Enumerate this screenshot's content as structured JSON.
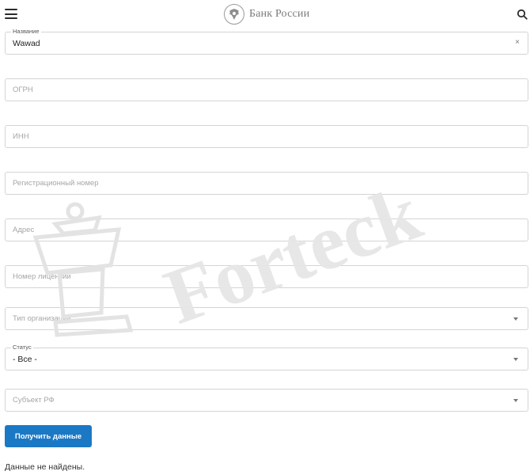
{
  "header": {
    "logo_text": "Банк России",
    "menu_icon": "hamburger-icon",
    "search_icon": "search-icon",
    "logo_icon": "double-eagle-emblem"
  },
  "form": {
    "name": {
      "legend": "Название",
      "value": "Wawad",
      "clear": "×"
    },
    "ogrn": {
      "placeholder": "ОГРН"
    },
    "inn": {
      "placeholder": "ИНН"
    },
    "reg_number": {
      "placeholder": "Регистрационный номер"
    },
    "address": {
      "placeholder": "Адрес"
    },
    "license_number": {
      "placeholder": "Номер лицензии"
    },
    "org_type": {
      "placeholder": "Тип организации"
    },
    "status": {
      "legend": "Статус",
      "value": "- Все -"
    },
    "region": {
      "placeholder": "Субъект РФ"
    },
    "submit_label": "Получить данные"
  },
  "result": {
    "message": "Данные не найдены."
  },
  "watermark": {
    "text": "Forteck",
    "color": "#e6e6e6"
  },
  "colors": {
    "accent": "#1b78c5"
  }
}
